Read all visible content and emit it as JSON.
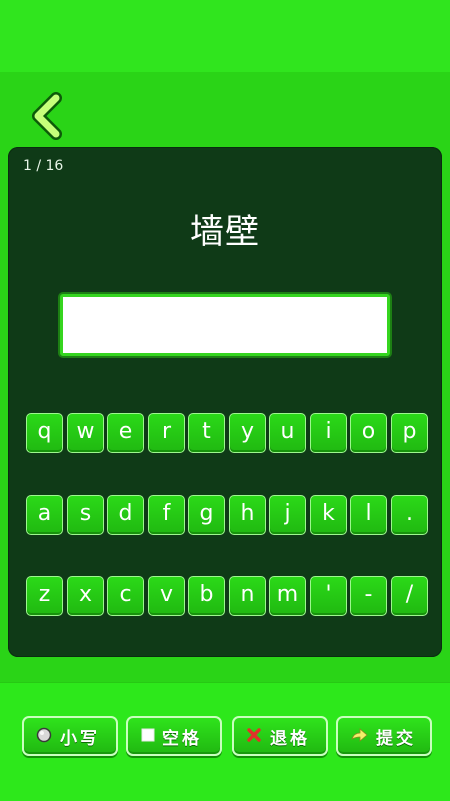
{
  "header": {
    "back_icon": "chevron-left-icon"
  },
  "progress": {
    "text": "1 / 16",
    "current": 1,
    "total": 16
  },
  "word": "墙壁",
  "answer": {
    "value": "",
    "placeholder": ""
  },
  "keyboard": {
    "rows": [
      [
        "q",
        "w",
        "e",
        "r",
        "t",
        "y",
        "u",
        "i",
        "o",
        "p"
      ],
      [
        "a",
        "s",
        "d",
        "f",
        "g",
        "h",
        "j",
        "k",
        "l",
        "."
      ],
      [
        "z",
        "x",
        "c",
        "v",
        "b",
        "n",
        "m",
        "'",
        "-",
        "/"
      ]
    ]
  },
  "buttons": {
    "lowercase": {
      "label": "小写",
      "icon": "radio-circle-icon"
    },
    "space": {
      "label": "空格",
      "icon": "square-icon"
    },
    "backspace": {
      "label": "退格",
      "icon": "red-x-icon"
    },
    "submit": {
      "label": "提交",
      "icon": "arrow-right-icon"
    }
  },
  "colors": {
    "background": "#2ee61c",
    "panel": "#0f3a17",
    "key": "#22c412",
    "accent_red": "#e0322a"
  }
}
